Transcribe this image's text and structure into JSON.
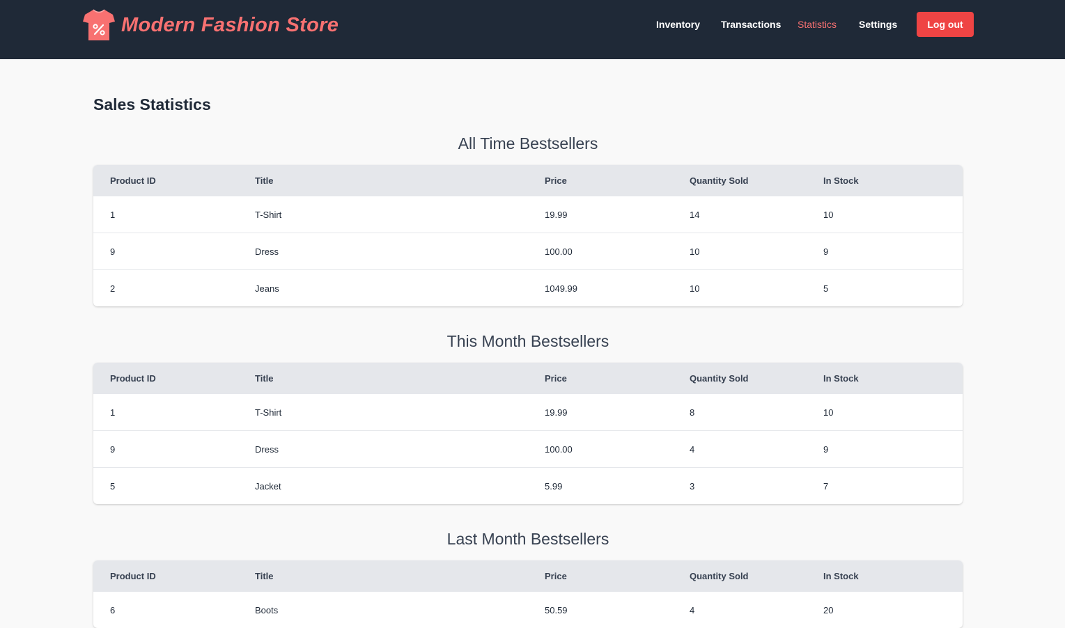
{
  "colors": {
    "navbar_bg": "#1f2937",
    "accent": "#f87171",
    "logout_bg": "#ef4444",
    "table_header_bg": "#e5e7eb",
    "page_bg": "#f9f9f9"
  },
  "brand": {
    "name": "Modern Fashion Store",
    "logo_icon": "tshirt-percent-icon"
  },
  "nav": {
    "items": [
      {
        "label": "Inventory",
        "active": false
      },
      {
        "label": "Transactions",
        "active": false
      },
      {
        "label": "Statistics",
        "active": true
      },
      {
        "label": "Settings",
        "active": false
      }
    ],
    "logout_label": "Log out"
  },
  "page": {
    "title": "Sales Statistics"
  },
  "columns": [
    "Product ID",
    "Title",
    "Price",
    "Quantity Sold",
    "In Stock"
  ],
  "sections": [
    {
      "heading": "All Time Bestsellers",
      "rows": [
        [
          "1",
          "T-Shirt",
          "19.99",
          "14",
          "10"
        ],
        [
          "9",
          "Dress",
          "100.00",
          "10",
          "9"
        ],
        [
          "2",
          "Jeans",
          "1049.99",
          "10",
          "5"
        ]
      ]
    },
    {
      "heading": "This Month Bestsellers",
      "rows": [
        [
          "1",
          "T-Shirt",
          "19.99",
          "8",
          "10"
        ],
        [
          "9",
          "Dress",
          "100.00",
          "4",
          "9"
        ],
        [
          "5",
          "Jacket",
          "5.99",
          "3",
          "7"
        ]
      ]
    },
    {
      "heading": "Last Month Bestsellers",
      "rows": [
        [
          "6",
          "Boots",
          "50.59",
          "4",
          "20"
        ]
      ]
    }
  ]
}
